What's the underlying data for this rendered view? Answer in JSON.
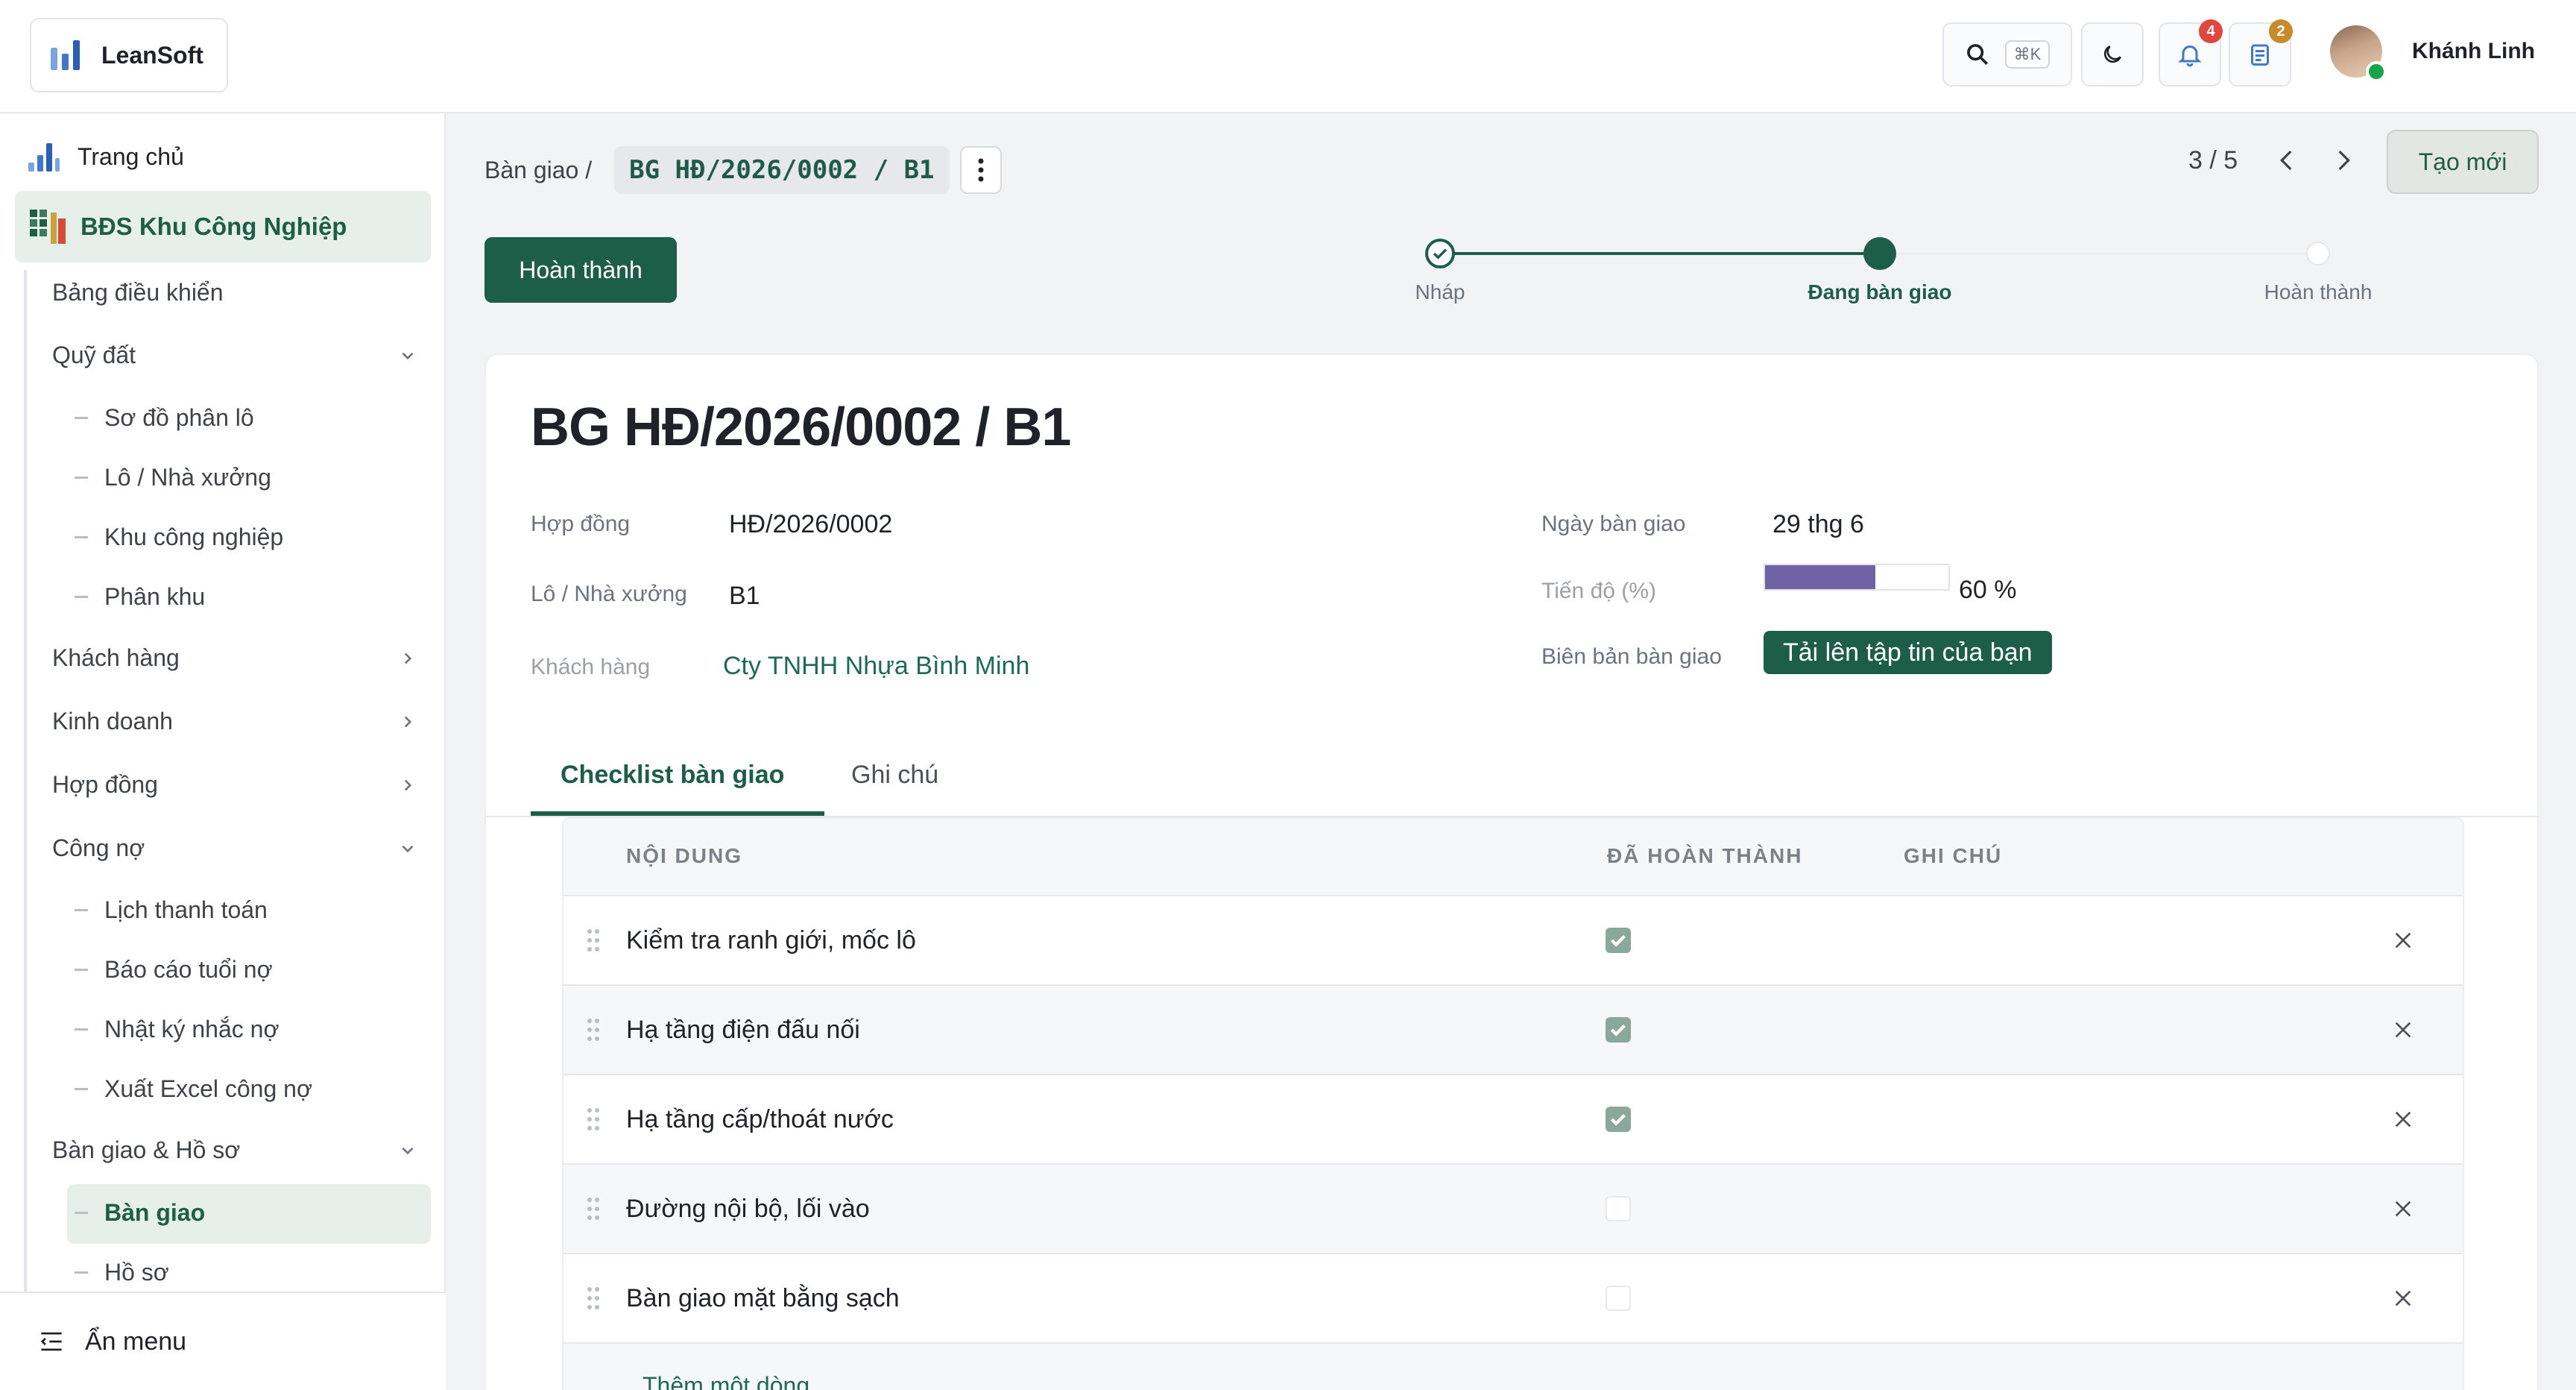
{
  "app": {
    "name": "LeanSoft"
  },
  "header": {
    "search_shortcut": "⌘K",
    "notifications_count": "4",
    "activities_count": "2",
    "user_name": "Khánh Linh"
  },
  "sidebar": {
    "home": "Trang chủ",
    "module": "BĐS Khu Công Nghiệp",
    "dashboard": "Bảng điều khiển",
    "land": "Quỹ đất",
    "land_items": [
      "Sơ đồ phân lô",
      "Lô / Nhà xưởng",
      "Khu công nghiệp",
      "Phân khu"
    ],
    "customers": "Khách hàng",
    "business": "Kinh doanh",
    "contracts": "Hợp đồng",
    "debt": "Công nợ",
    "debt_items": [
      "Lịch thanh toán",
      "Báo cáo tuổi nợ",
      "Nhật ký nhắc nợ",
      "Xuất Excel công nợ"
    ],
    "handover": "Bàn giao & Hồ sơ",
    "handover_items": [
      "Bàn giao",
      "Hồ sơ"
    ],
    "hide_menu": "Ẩn menu"
  },
  "breadcrumb": {
    "parent": "Bàn giao /",
    "current": "BG HĐ/2026/0002 / B1"
  },
  "pager": {
    "text": "3 / 5"
  },
  "actions": {
    "new": "Tạo mới",
    "complete": "Hoàn thành"
  },
  "stages": [
    {
      "label": "Nháp",
      "state": "done"
    },
    {
      "label": "Đang bàn giao",
      "state": "current"
    },
    {
      "label": "Hoàn thành",
      "state": "todo"
    }
  ],
  "record": {
    "title": "BG HĐ/2026/0002 / B1",
    "fields": {
      "contract_label": "Hợp đồng",
      "contract_value": "HĐ/2026/0002",
      "lot_label": "Lô / Nhà xưởng",
      "lot_value": "B1",
      "customer_label": "Khách hàng",
      "customer_value": "Cty TNHH Nhựa Bình Minh",
      "date_label": "Ngày bàn giao",
      "date_value": "29 thg 6",
      "progress_label": "Tiến độ (%)",
      "progress_value": 60,
      "progress_text": "60 %",
      "minutes_label": "Biên bản bàn giao",
      "upload_label": "Tải lên tập tin của bạn"
    }
  },
  "tabs": [
    "Checklist bàn giao",
    "Ghi chú"
  ],
  "checklist": {
    "headers": [
      "NỘI DUNG",
      "ĐÃ HOÀN THÀNH",
      "GHI CHÚ"
    ],
    "rows": [
      {
        "content": "Kiểm tra ranh giới, mốc lô",
        "done": true
      },
      {
        "content": "Hạ tầng điện đấu nối",
        "done": true
      },
      {
        "content": "Hạ tầng cấp/thoát nước",
        "done": true
      },
      {
        "content": "Đường nội bộ, lối vào",
        "done": false
      },
      {
        "content": "Bàn giao mặt bằng sạch",
        "done": false
      }
    ],
    "add_line": "Thêm một dòng"
  },
  "colors": {
    "primary": "#1d5e49",
    "progress": "#6f63a6",
    "notif_badge": "#e0463c",
    "activity_badge": "#c98a2b"
  }
}
